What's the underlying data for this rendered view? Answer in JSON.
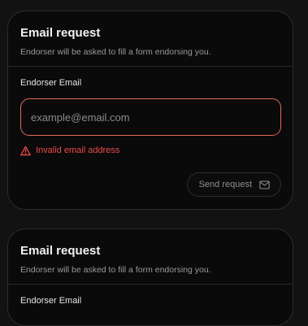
{
  "cards": [
    {
      "title": "Email request",
      "description": "Endorser will be asked to fill a form endorsing you.",
      "field_label": "Endorser Email",
      "email_placeholder": "example@email.com",
      "email_value": "",
      "error_text": "Invalid email address",
      "send_label": "Send request"
    },
    {
      "title": "Email request",
      "description": "Endorser will be asked to fill a form endorsing you.",
      "field_label": "Endorser Email"
    }
  ],
  "colors": {
    "error": "#ef4a4a",
    "input_border_error": "#e36a5b",
    "card_background": "#0a0a0a",
    "page_background": "#121212"
  },
  "icons": {
    "error": "warning-triangle-icon",
    "send": "mail-icon"
  }
}
